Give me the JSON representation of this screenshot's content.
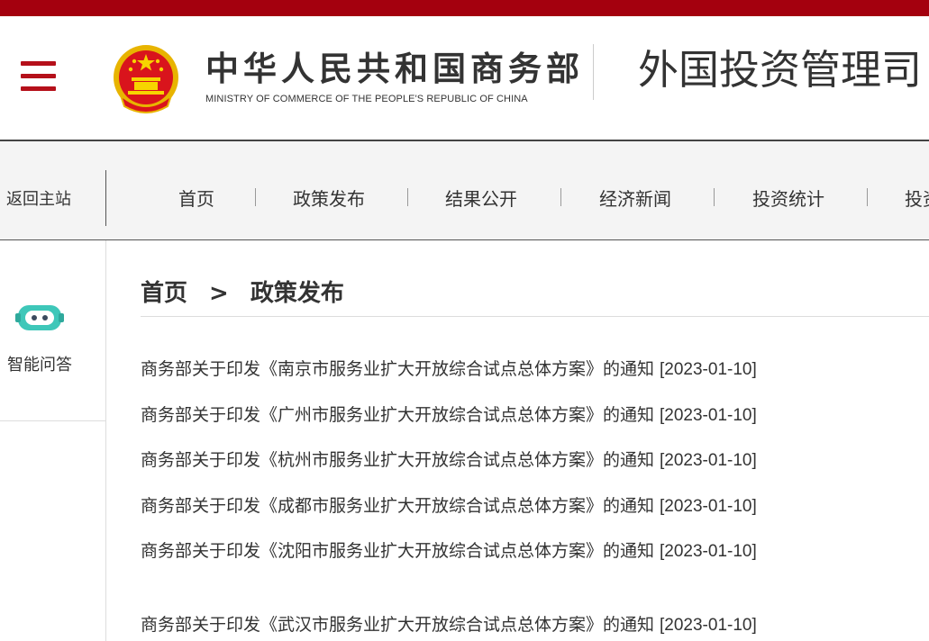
{
  "header": {
    "ministry_cn": "中华人民共和国商务部",
    "ministry_en": "MINISTRY OF COMMERCE OF THE PEOPLE'S REPUBLIC OF CHINA",
    "department_title": "外国投资管理司",
    "menu_icon": "hamburger-menu-icon",
    "emblem_icon": "national-emblem-icon"
  },
  "nav": {
    "return_label": "返回主站",
    "items": [
      "首页",
      "政策发布",
      "结果公开",
      "经济新闻",
      "投资统计",
      "投资"
    ]
  },
  "sidebar": {
    "robot_icon": "chatbot-icon",
    "qa_label": "智能问答"
  },
  "breadcrumb": {
    "home": "首页",
    "separator": ">",
    "current": "政策发布"
  },
  "articles": [
    {
      "title": "商务部关于印发《南京市服务业扩大开放综合试点总体方案》的通知",
      "date": "[2023-01-10]"
    },
    {
      "title": "商务部关于印发《广州市服务业扩大开放综合试点总体方案》的通知",
      "date": "[2023-01-10]"
    },
    {
      "title": "商务部关于印发《杭州市服务业扩大开放综合试点总体方案》的通知",
      "date": "[2023-01-10]"
    },
    {
      "title": "商务部关于印发《成都市服务业扩大开放综合试点总体方案》的通知",
      "date": "[2023-01-10]"
    },
    {
      "title": "商务部关于印发《沈阳市服务业扩大开放综合试点总体方案》的通知",
      "date": "[2023-01-10]"
    },
    {
      "title": "商务部关于印发《武汉市服务业扩大开放综合试点总体方案》的通知",
      "date": "[2023-01-10]"
    }
  ],
  "colors": {
    "brand_red": "#a4000e",
    "menu_red": "#b5101a",
    "robot_teal": "#3ec7b9"
  }
}
